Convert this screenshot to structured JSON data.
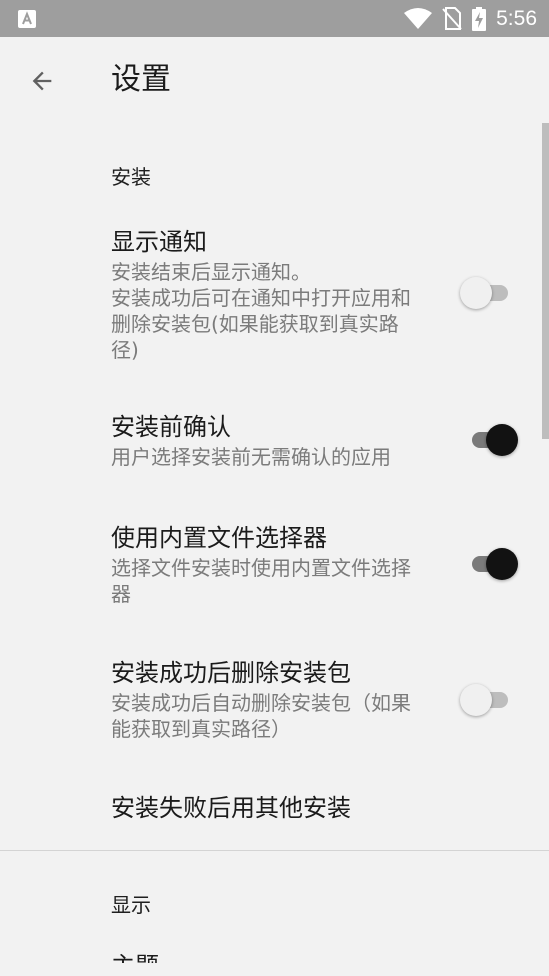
{
  "status_bar": {
    "time": "5:56",
    "icons": [
      "app-notification-icon",
      "wifi-icon",
      "no-sim-icon",
      "battery-charging-icon"
    ]
  },
  "toolbar": {
    "back_icon": "arrow-back-icon",
    "title": "设置"
  },
  "sections": [
    {
      "header": "安装",
      "items": [
        {
          "title": "显示通知",
          "summary": "安装结束后显示通知。\n安装成功后可在通知中打开应用和删除安装包(如果能获取到真实路径)",
          "switch": "off"
        },
        {
          "title": "安装前确认",
          "summary": "用户选择安装前无需确认的应用",
          "switch": "on"
        },
        {
          "title": "使用内置文件选择器",
          "summary": "选择文件安装时使用内置文件选择器",
          "switch": "on"
        },
        {
          "title": "安装成功后删除安装包",
          "summary": "安装成功后自动删除安装包（如果能获取到真实路径）",
          "switch": "off"
        },
        {
          "title": "安装失败后用其他安装"
        }
      ]
    },
    {
      "header": "显示",
      "items": [
        {
          "title": "主题"
        }
      ]
    }
  ],
  "colors": {
    "background": "#f2f2f2",
    "status_bar": "#9e9e9e",
    "summary_text": "#7b7b7b",
    "switch_on_thumb": "#121212"
  }
}
